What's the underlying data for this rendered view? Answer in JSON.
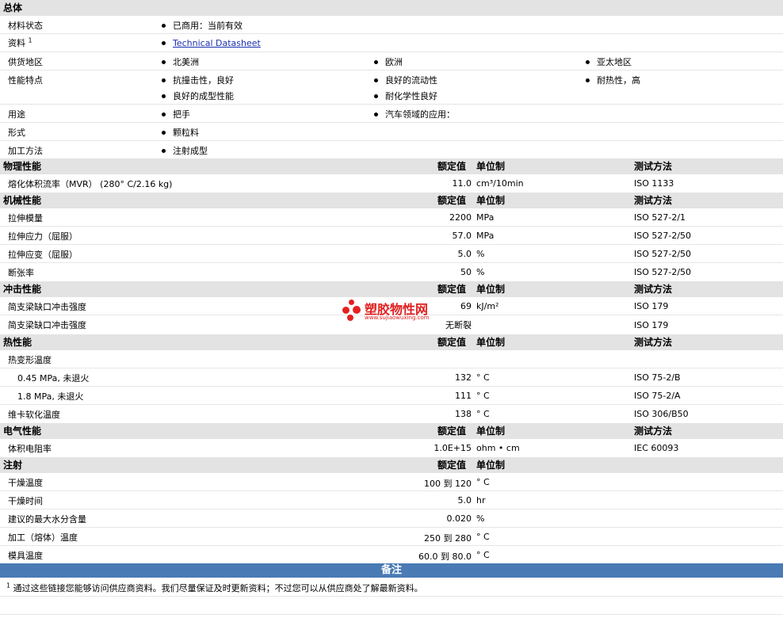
{
  "general": {
    "header": "总体",
    "material_status": {
      "label": "材料状态",
      "value": "已商用：当前有效"
    },
    "literature": {
      "label": "资料",
      "sup": "1",
      "link": "Technical Datasheet"
    },
    "availability": {
      "label": "供货地区",
      "values": [
        "北美洲",
        "欧洲",
        "亚太地区"
      ]
    },
    "features": {
      "label": "性能特点",
      "values": [
        "抗撞击性，良好",
        "良好的流动性",
        "耐热性，高",
        "良好的成型性能",
        "耐化学性良好"
      ]
    },
    "uses": {
      "label": "用途",
      "values": [
        "把手",
        "汽车领域的应用："
      ]
    },
    "forms": {
      "label": "形式",
      "value": "颗粒料"
    },
    "processing": {
      "label": "加工方法",
      "value": "注射成型"
    }
  },
  "col_headers": {
    "nominal": "额定值",
    "unit": "单位制",
    "test": "测试方法"
  },
  "physical": {
    "header": "物理性能",
    "rows": [
      {
        "label": "熔化体积流率（MVR） (280° C/2.16 kg)",
        "value": "11.0",
        "unit": "cm³/10min",
        "test": "ISO 1133"
      }
    ]
  },
  "mechanical": {
    "header": "机械性能",
    "rows": [
      {
        "label": "拉伸模量",
        "value": "2200",
        "unit": "MPa",
        "test": "ISO 527-2/1"
      },
      {
        "label": "拉伸应力（屈服）",
        "value": "57.0",
        "unit": "MPa",
        "test": "ISO 527-2/50"
      },
      {
        "label": "拉伸应变（屈服）",
        "value": "5.0",
        "unit": "%",
        "test": "ISO 527-2/50"
      },
      {
        "label": "断张率",
        "value": "50",
        "unit": "%",
        "test": "ISO 527-2/50"
      }
    ]
  },
  "impact": {
    "header": "冲击性能",
    "rows": [
      {
        "label": "简支梁缺口冲击强度",
        "value": "69",
        "unit": "kJ/m²",
        "test": "ISO 179"
      },
      {
        "label": "简支梁缺口冲击强度",
        "value": "无断裂",
        "unit": "",
        "test": "ISO 179"
      }
    ]
  },
  "thermal": {
    "header": "热性能",
    "rows": [
      {
        "label": "热变形温度",
        "value": "",
        "unit": "",
        "test": ""
      },
      {
        "label": "0.45 MPa, 未退火",
        "value": "132",
        "unit": "° C",
        "test": "ISO 75-2/B"
      },
      {
        "label": "1.8 MPa, 未退火",
        "value": "111",
        "unit": "° C",
        "test": "ISO 75-2/A"
      },
      {
        "label": "维卡软化温度",
        "value": "138",
        "unit": "° C",
        "test": "ISO 306/B50"
      }
    ]
  },
  "electrical": {
    "header": "电气性能",
    "rows": [
      {
        "label": "体积电阻率",
        "value": "1.0E+15",
        "unit": "ohm • cm",
        "test": "IEC 60093"
      }
    ]
  },
  "injection": {
    "header": "注射",
    "rows": [
      {
        "label": "干燥温度",
        "value": "100 到 120",
        "unit": "° C"
      },
      {
        "label": "干燥时间",
        "value": "5.0",
        "unit": "hr"
      },
      {
        "label": "建议的最大水分含量",
        "value": "0.020",
        "unit": "%"
      },
      {
        "label": "加工（熔体）温度",
        "value": "250 到 280",
        "unit": "° C"
      },
      {
        "label": "模具温度",
        "value": "60.0 到 80.0",
        "unit": "° C"
      }
    ]
  },
  "notes": {
    "header": "备注",
    "sup": "1",
    "text": "通过这些链接您能够访问供应商资料。我们尽量保证及时更新资料；不过您可以从供应商处了解最新资料。"
  },
  "watermark": {
    "title": "塑胶物性网",
    "url": "www.sujiaowuxing.com"
  }
}
